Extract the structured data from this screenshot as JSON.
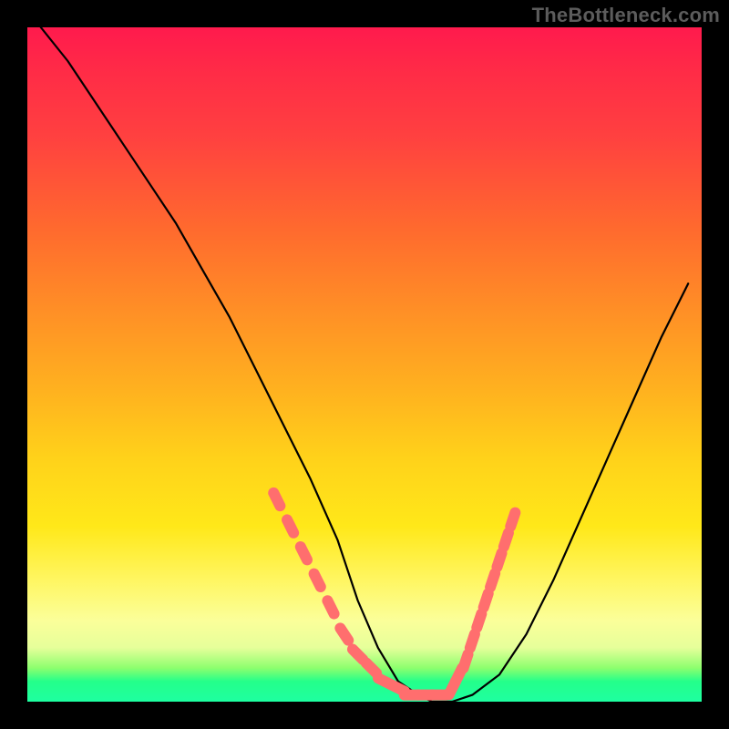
{
  "watermark": "TheBottleneck.com",
  "chart_data": {
    "type": "line",
    "title": "",
    "xlabel": "",
    "ylabel": "",
    "xlim": [
      0,
      100
    ],
    "ylim": [
      0,
      100
    ],
    "grid": false,
    "legend": false,
    "annotations": [],
    "series": [
      {
        "name": "black-curve",
        "color": "#000000",
        "x": [
          2,
          6,
          10,
          14,
          18,
          22,
          26,
          30,
          34,
          38,
          42,
          46,
          49,
          52,
          55,
          58,
          60,
          63,
          66,
          70,
          74,
          78,
          82,
          86,
          90,
          94,
          98
        ],
        "y": [
          100,
          95,
          89,
          83,
          77,
          71,
          64,
          57,
          49,
          41,
          33,
          24,
          15,
          8,
          3,
          1,
          0,
          0,
          1,
          4,
          10,
          18,
          27,
          36,
          45,
          54,
          62
        ]
      },
      {
        "name": "red-dot-overlay-left",
        "color": "#ff6e6e",
        "style": "dotted-thick",
        "x": [
          37,
          39,
          41,
          43,
          45,
          47,
          49,
          51,
          53,
          55,
          57,
          59,
          61
        ],
        "y": [
          30,
          26,
          22,
          18,
          14,
          10,
          7,
          5,
          3,
          2,
          1,
          1,
          1
        ]
      },
      {
        "name": "red-dot-overlay-right",
        "color": "#ff6e6e",
        "style": "dotted-thick",
        "x": [
          63,
          64,
          65,
          66,
          67,
          68,
          69,
          70,
          71,
          72
        ],
        "y": [
          2,
          4,
          6,
          9,
          12,
          15,
          18,
          21,
          24,
          27
        ]
      }
    ]
  }
}
